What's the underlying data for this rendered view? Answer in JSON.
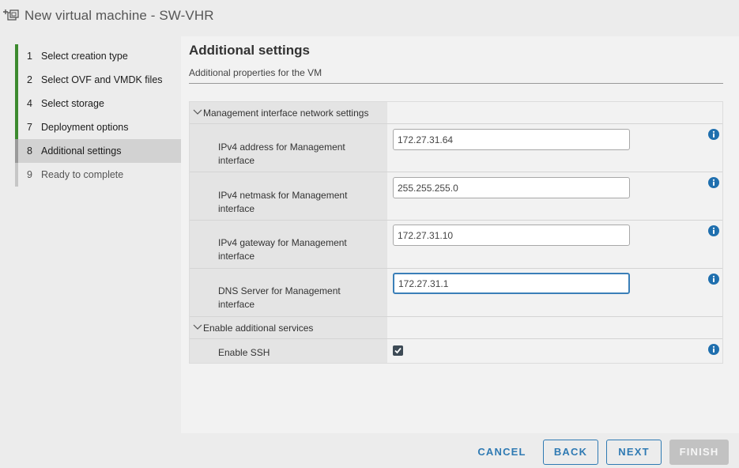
{
  "window": {
    "title": "New virtual machine - SW-VHR"
  },
  "sidebar": {
    "steps": [
      {
        "num": "1",
        "label": "Select creation type",
        "state": "done"
      },
      {
        "num": "2",
        "label": "Select OVF and VMDK files",
        "state": "done"
      },
      {
        "num": "4",
        "label": "Select storage",
        "state": "done"
      },
      {
        "num": "7",
        "label": "Deployment options",
        "state": "done"
      },
      {
        "num": "8",
        "label": "Additional settings",
        "state": "current"
      },
      {
        "num": "9",
        "label": "Ready to complete",
        "state": "pending"
      }
    ]
  },
  "main": {
    "title": "Additional settings",
    "subtitle": "Additional properties for the VM",
    "groups": [
      {
        "label": "Management interface network settings",
        "fields": [
          {
            "label": "IPv4 address for Management interface",
            "value": "172.27.31.64"
          },
          {
            "label": "IPv4 netmask for Management interface",
            "value": "255.255.255.0"
          },
          {
            "label": "IPv4 gateway for Management interface",
            "value": "172.27.31.10"
          },
          {
            "label": "DNS Server for Management interface",
            "value": "172.27.31.1"
          }
        ]
      },
      {
        "label": "Enable additional services",
        "fields": [
          {
            "label": "Enable SSH",
            "checked": true
          }
        ]
      }
    ]
  },
  "footer": {
    "cancel": "CANCEL",
    "back": "BACK",
    "next": "NEXT",
    "finish": "FINISH"
  },
  "colors": {
    "accent": "#2f7ab3",
    "done_step": "#3c8a2e",
    "info_icon": "#1f6fae",
    "disabled_button": "#c2c2c2"
  }
}
